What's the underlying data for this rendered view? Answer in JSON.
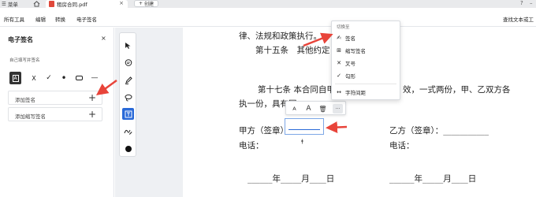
{
  "titlebar": {
    "menu_label": "菜单",
    "tab_title": "租房合同.pdf",
    "tab_close": "×",
    "new_tab_plus": "+",
    "new_tab_label": "创建"
  },
  "menubar": {
    "items": [
      "所有工具",
      "编辑",
      "转换",
      "电子签名"
    ],
    "find": "查找文本或工"
  },
  "left_panel": {
    "title": "电子签名",
    "close": "×",
    "subtitle": "自己填写并签名",
    "tools": {
      "text_glyph": "A",
      "x": "X",
      "check": "✓",
      "dot": "•",
      "box": "",
      "line": "—"
    },
    "rows": [
      {
        "label": "添加签名",
        "plus": "+"
      },
      {
        "label": "添加缩写签名",
        "plus": "+"
      }
    ]
  },
  "document": {
    "line1": "律、法规和政策执行。",
    "line2": "第十五条　其他约定",
    "line3_left": "第十七条  本合同自甲",
    "line3_right": "效，一式两份，甲、乙双方各",
    "line4": "执一份，具有同",
    "party_a": "甲方（签章）：",
    "party_b": "乙方（签章）：___________",
    "phone_a": "电话：",
    "phone_b": "电话：",
    "date_a": "______年_____月____日",
    "date_b": "______年_____月____日",
    "caret": "ǂ"
  },
  "float_toolbar": {
    "small_a": "A",
    "big_a": "A",
    "trash": "🗑",
    "more": "···"
  },
  "dropdown": {
    "header": "切换至",
    "items": [
      {
        "icon": "signature-icon",
        "glyph": "✍",
        "label": "签名"
      },
      {
        "icon": "initials-icon",
        "glyph": "⊞",
        "label": "缩写签名"
      },
      {
        "icon": "cross-icon",
        "glyph": "✕",
        "label": "叉号"
      },
      {
        "icon": "check-icon",
        "glyph": "✓",
        "label": "勾形"
      },
      {
        "icon": "char-spacing-icon",
        "glyph": "↔",
        "label": "字符间距"
      }
    ]
  },
  "colors": {
    "accent": "#2a6ad8",
    "arrow": "#e8443a"
  }
}
